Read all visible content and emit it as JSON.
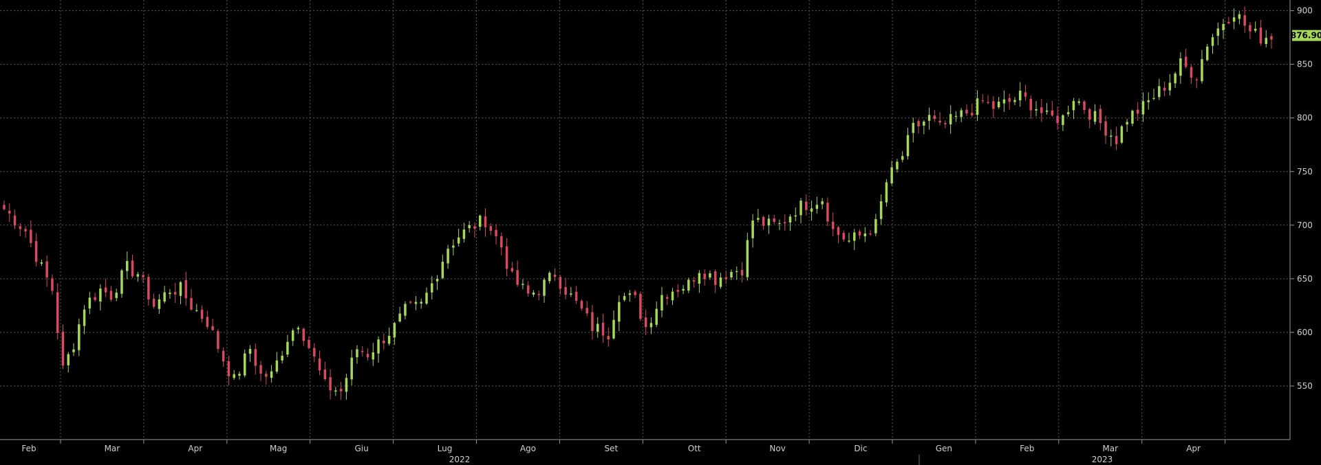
{
  "chart_data": {
    "type": "candlestick",
    "title": "",
    "xlabel": "",
    "ylabel": "",
    "ylim": [
      500,
      910
    ],
    "y_ticks": [
      550,
      600,
      650,
      700,
      750,
      800,
      850,
      900
    ],
    "x_ticks": [
      "Feb",
      "Mar",
      "Apr",
      "Mag",
      "Giu",
      "Lug",
      "Ago",
      "Set",
      "Ott",
      "Nov",
      "Dic",
      "Gen",
      "Feb",
      "Mar",
      "Apr"
    ],
    "years": [
      "2022",
      "2023"
    ],
    "last_price": "876.90",
    "grid": true,
    "colors": {
      "up": "#a6d85a",
      "down": "#d84a5f",
      "grid": "#5a5a5a",
      "last_badge": "#a6d85a"
    },
    "anchors": [
      [
        0,
        715
      ],
      [
        4,
        695
      ],
      [
        7,
        660
      ],
      [
        9,
        640
      ],
      [
        11,
        565
      ],
      [
        13,
        590
      ],
      [
        15,
        625
      ],
      [
        18,
        640
      ],
      [
        20,
        635
      ],
      [
        23,
        660
      ],
      [
        25,
        655
      ],
      [
        28,
        625
      ],
      [
        31,
        640
      ],
      [
        33,
        640
      ],
      [
        35,
        625
      ],
      [
        38,
        610
      ],
      [
        41,
        575
      ],
      [
        43,
        555
      ],
      [
        46,
        585
      ],
      [
        48,
        560
      ],
      [
        50,
        560
      ],
      [
        53,
        595
      ],
      [
        55,
        610
      ],
      [
        58,
        575
      ],
      [
        60,
        550
      ],
      [
        63,
        545
      ],
      [
        66,
        585
      ],
      [
        68,
        580
      ],
      [
        71,
        595
      ],
      [
        73,
        605
      ],
      [
        75,
        620
      ],
      [
        78,
        625
      ],
      [
        80,
        645
      ],
      [
        83,
        680
      ],
      [
        85,
        690
      ],
      [
        88,
        700
      ],
      [
        90,
        705
      ],
      [
        93,
        680
      ],
      [
        95,
        650
      ],
      [
        98,
        635
      ],
      [
        100,
        640
      ],
      [
        103,
        655
      ],
      [
        105,
        640
      ],
      [
        108,
        620
      ],
      [
        110,
        605
      ],
      [
        113,
        600
      ],
      [
        115,
        635
      ],
      [
        118,
        630
      ],
      [
        120,
        605
      ],
      [
        123,
        635
      ],
      [
        125,
        640
      ],
      [
        128,
        645
      ],
      [
        130,
        660
      ],
      [
        133,
        650
      ],
      [
        135,
        655
      ],
      [
        138,
        660
      ],
      [
        140,
        705
      ],
      [
        143,
        700
      ],
      [
        145,
        700
      ],
      [
        148,
        715
      ],
      [
        150,
        720
      ],
      [
        153,
        725
      ],
      [
        155,
        695
      ],
      [
        158,
        685
      ],
      [
        160,
        690
      ],
      [
        163,
        700
      ],
      [
        165,
        740
      ],
      [
        168,
        765
      ],
      [
        170,
        790
      ],
      [
        173,
        800
      ],
      [
        175,
        790
      ],
      [
        178,
        800
      ],
      [
        180,
        805
      ],
      [
        183,
        815
      ],
      [
        185,
        810
      ],
      [
        188,
        815
      ],
      [
        190,
        820
      ],
      [
        193,
        810
      ],
      [
        195,
        800
      ],
      [
        198,
        800
      ],
      [
        200,
        820
      ],
      [
        203,
        805
      ],
      [
        205,
        795
      ],
      [
        208,
        780
      ],
      [
        210,
        800
      ],
      [
        213,
        810
      ],
      [
        215,
        820
      ],
      [
        218,
        835
      ],
      [
        220,
        850
      ],
      [
        223,
        840
      ],
      [
        225,
        870
      ],
      [
        228,
        890
      ],
      [
        230,
        900
      ],
      [
        233,
        880
      ],
      [
        235,
        875
      ],
      [
        237,
        877
      ]
    ]
  }
}
